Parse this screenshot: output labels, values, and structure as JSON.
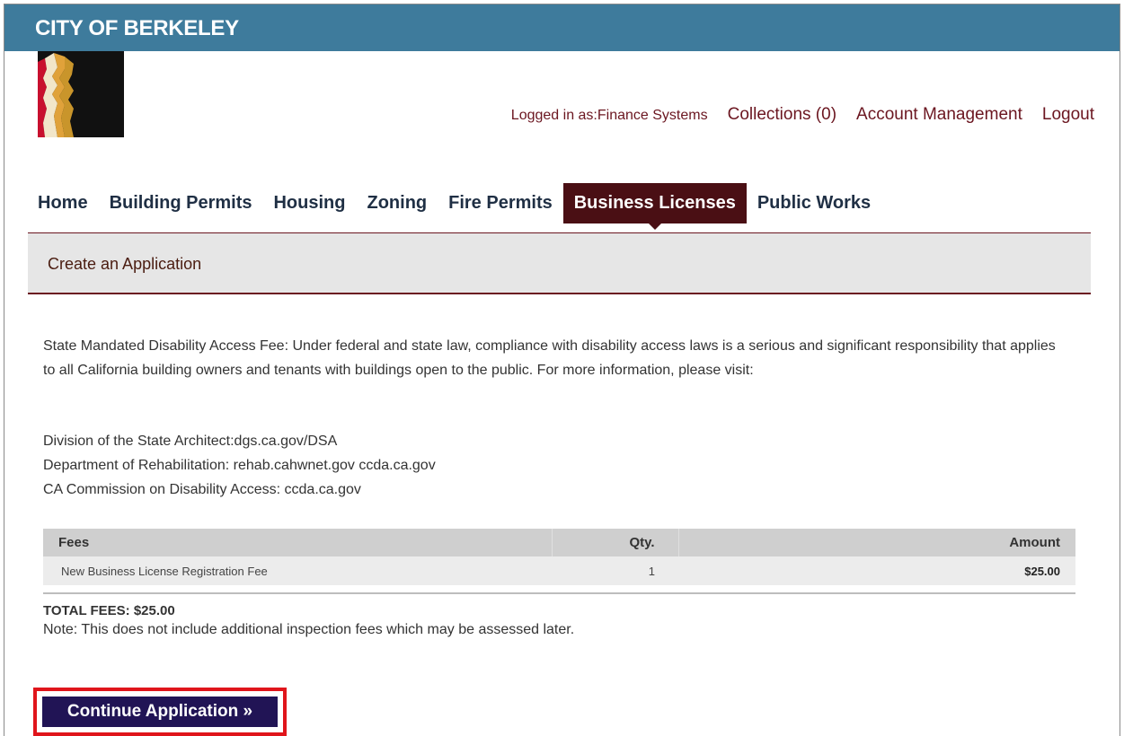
{
  "header": {
    "city": "CITY OF BERKELEY"
  },
  "user_links": {
    "logged_in": "Logged in as:Finance Systems",
    "collections": "Collections (0)",
    "account": "Account Management",
    "logout": "Logout"
  },
  "nav": {
    "items": [
      "Home",
      "Building Permits",
      "Housing",
      "Zoning",
      "Fire Permits",
      "Business Licenses",
      "Public Works"
    ],
    "active": "Business Licenses"
  },
  "section": {
    "title": "Create an Application"
  },
  "notice": {
    "text": "State Mandated Disability Access Fee: Under federal and state law, compliance with disability access laws is a serious and significant responsibility that applies to all California building owners and tenants with buildings open to the public. For more information, please visit:"
  },
  "links": [
    "Division of the State Architect:dgs.ca.gov/DSA",
    "Department of Rehabilitation: rehab.cahwnet.gov ccda.ca.gov",
    "CA Commission on Disability Access: ccda.ca.gov"
  ],
  "fees_table": {
    "headers": [
      "Fees",
      "Qty.",
      "Amount"
    ],
    "rows": [
      {
        "fee": "New Business License Registration Fee",
        "qty": "1",
        "amount": "$25.00"
      }
    ]
  },
  "totals": {
    "total": "TOTAL FEES: $25.00",
    "note": "Note: This does not include additional inspection fees which may be assessed later."
  },
  "actions": {
    "continue_label": "Continue Application »"
  },
  "colors": {
    "topbar": "#3e7b9c",
    "link_maroon": "#6b1620",
    "nav_active": "#4a0f14",
    "button": "#211455",
    "highlight": "#e0151b"
  }
}
